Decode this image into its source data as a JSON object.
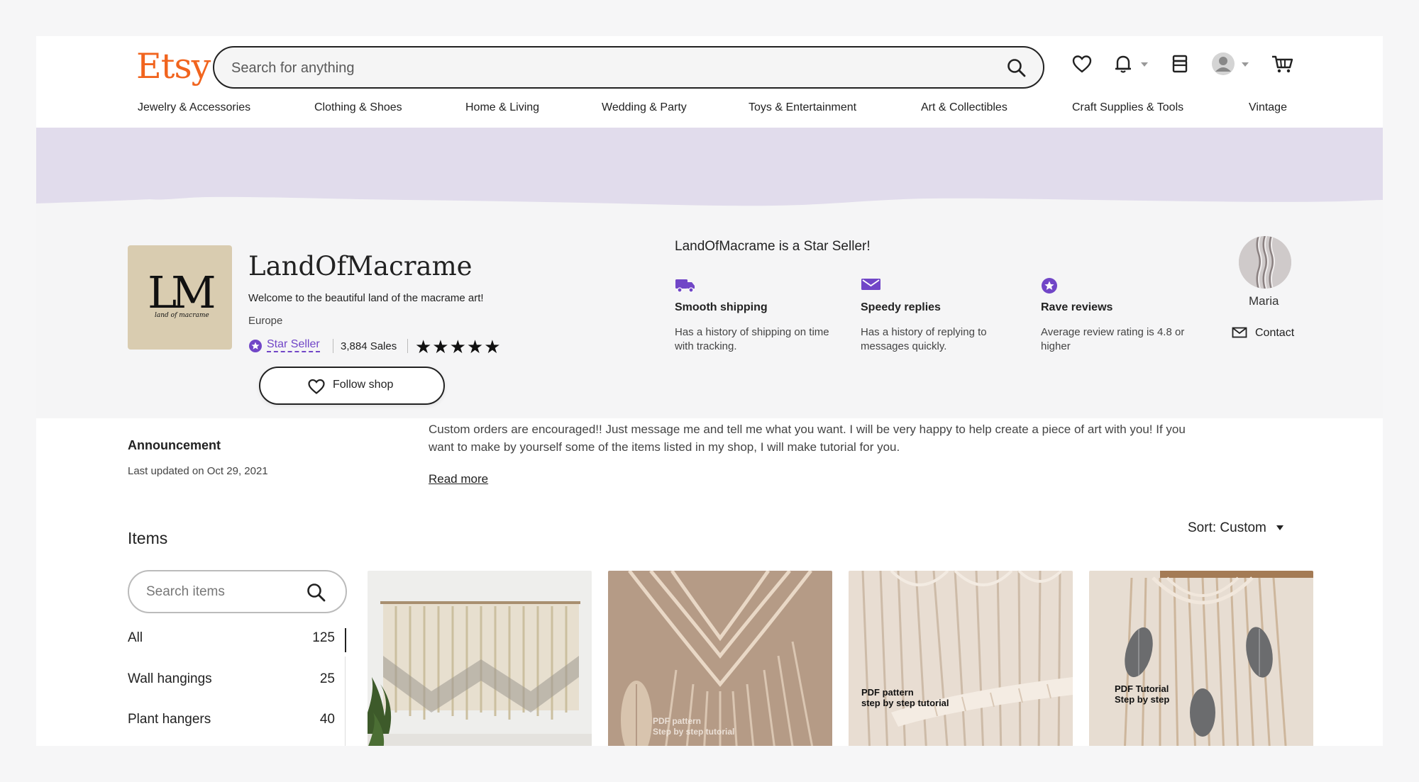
{
  "header": {
    "logo": "Etsy",
    "search_placeholder": "Search for anything",
    "categories": [
      "Jewelry & Accessories",
      "Clothing & Shoes",
      "Home & Living",
      "Wedding & Party",
      "Toys & Entertainment",
      "Art & Collectibles",
      "Craft Supplies & Tools",
      "Vintage"
    ],
    "icons": [
      "search-icon",
      "favorites-heart-icon",
      "notifications-bell-icon",
      "shop-manager-icon",
      "account-avatar-icon",
      "cart-icon"
    ]
  },
  "shop": {
    "logo_text": "LM",
    "logo_subtext": "land of macrame",
    "name": "LandOfMacrame",
    "tagline": "Welcome to the beautiful land of the macrame art!",
    "region": "Europe",
    "star_seller_label": "Star Seller",
    "sales": "3,884 Sales",
    "rating_stars": "★★★★★",
    "rating_value": 5,
    "follow_label": "Follow shop"
  },
  "star_seller": {
    "heading": "LandOfMacrame is a Star Seller!",
    "features": [
      {
        "icon": "truck-icon",
        "title": "Smooth shipping",
        "desc": "Has a history of shipping on time with tracking."
      },
      {
        "icon": "message-icon",
        "title": "Speedy replies",
        "desc": "Has a history of replying to messages quickly."
      },
      {
        "icon": "star-badge-icon",
        "title": "Rave reviews",
        "desc": "Average review rating is 4.8 or higher"
      }
    ]
  },
  "owner": {
    "name": "Maria",
    "contact_label": "Contact"
  },
  "announcement": {
    "title": "Announcement",
    "date": "Last updated on Oct 29, 2021",
    "text": "Custom orders are encouraged!! Just message me and tell me what you want. I will be very happy to help create a piece of art with you! If you want to make by yourself some of the items listed in my shop, I will make tutorial for you.",
    "read_more": "Read more"
  },
  "items": {
    "title": "Items",
    "sort_label": "Sort: Custom",
    "search_placeholder": "Search items",
    "sections": [
      {
        "name": "All",
        "count": "125"
      },
      {
        "name": "Wall hangings",
        "count": "25"
      },
      {
        "name": "Plant hangers",
        "count": "40"
      }
    ],
    "listings": [
      {
        "overlay": ""
      },
      {
        "overlay": "PDF pattern\nStep by step tutorial"
      },
      {
        "overlay": "PDF pattern\nstep by step tutorial"
      },
      {
        "overlay": "PDF Tutorial\nStep by step"
      }
    ]
  },
  "colors": {
    "brand": "#f1641e",
    "star_seller": "#7146c7",
    "banner": "#e1dcec"
  }
}
